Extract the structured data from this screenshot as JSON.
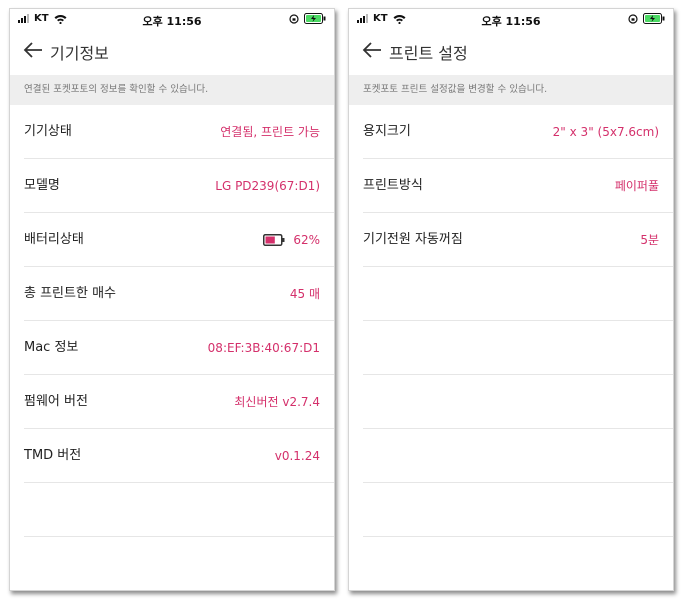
{
  "status_bar": {
    "carrier": "KT",
    "time": "오후 11:56"
  },
  "left": {
    "title": "기기정보",
    "banner": "연결된 포켓포토의 정보를 확인할 수 있습니다.",
    "rows": [
      {
        "label": "기기상태",
        "value": "연결됨, 프린트 가능"
      },
      {
        "label": "모델명",
        "value": "LG PD239(67:D1)"
      },
      {
        "label": "배터리상태",
        "value": "62%"
      },
      {
        "label": "총 프린트한 매수",
        "value": "45 매"
      },
      {
        "label": "Mac 정보",
        "value": "08:EF:3B:40:67:D1"
      },
      {
        "label": "펌웨어 버전",
        "value": "최신버전 v2.7.4"
      },
      {
        "label": "TMD 버전",
        "value": "v0.1.24"
      }
    ],
    "battery_level": 0.62
  },
  "right": {
    "title": "프린트 설정",
    "banner": "포켓포토 프린트 설정값을 변경할 수 있습니다.",
    "rows": [
      {
        "label": "용지크기",
        "value": "2\" x 3\" (5x7.6cm)"
      },
      {
        "label": "프린트방식",
        "value": "페이퍼풀"
      },
      {
        "label": "기기전원 자동꺼짐",
        "value": "5분"
      }
    ]
  },
  "colors": {
    "accent": "#d4306b",
    "banner_bg": "#eeeeee",
    "divider": "#e6e6e6"
  }
}
